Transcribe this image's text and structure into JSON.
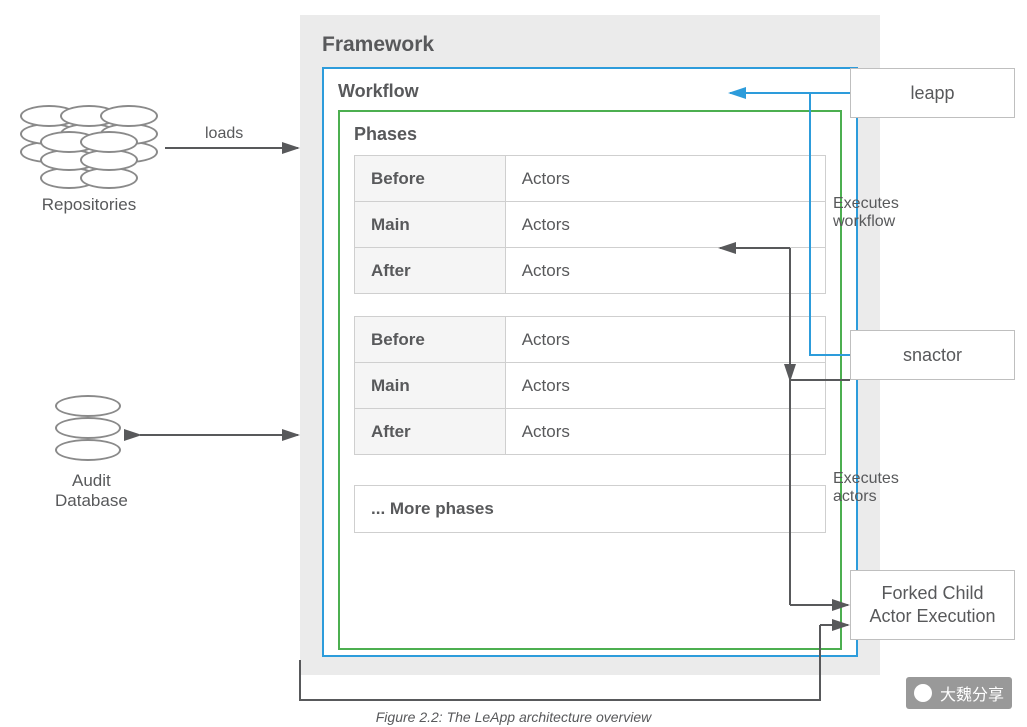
{
  "framework": {
    "title": "Framework"
  },
  "workflow": {
    "title": "Workflow"
  },
  "phases": {
    "title": "Phases",
    "group1": [
      {
        "stage": "Before",
        "content": "Actors"
      },
      {
        "stage": "Main",
        "content": "Actors"
      },
      {
        "stage": "After",
        "content": "Actors"
      }
    ],
    "group2": [
      {
        "stage": "Before",
        "content": "Actors"
      },
      {
        "stage": "Main",
        "content": "Actors"
      },
      {
        "stage": "After",
        "content": "Actors"
      }
    ],
    "more": "... More phases"
  },
  "external": {
    "repositories": "Repositories",
    "audit": "Audit\nDatabase",
    "leapp": "leapp",
    "snactor": "snactor",
    "forked": "Forked Child\nActor Execution"
  },
  "edges": {
    "loads": "loads",
    "executes_workflow": "Executes\nworkflow",
    "executes_actors": "Executes\nactors"
  },
  "caption": "Figure 2.2: The LeApp architecture overview",
  "watermark": "大魏分享"
}
